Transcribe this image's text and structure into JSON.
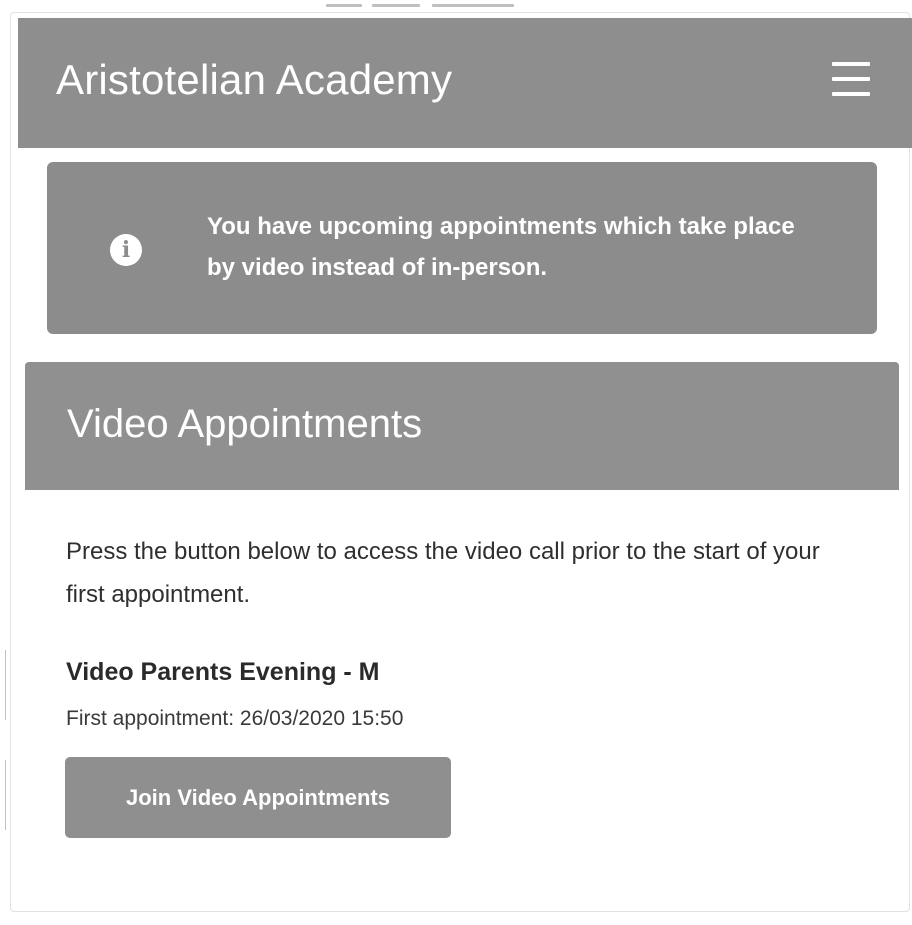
{
  "header": {
    "title": "Aristotelian Academy",
    "menu_icon": "hamburger-menu-icon"
  },
  "alert": {
    "icon": "info-icon",
    "icon_glyph": "i",
    "message": "You have upcoming appointments which take place by video instead of in-person."
  },
  "video_card": {
    "title": "Video Appointments",
    "instructions": "Press the button below to access the video call prior to the start of your first appointment.",
    "event_name": "Video Parents Evening - M",
    "first_appointment": "First appointment: 26/03/2020 15:50",
    "join_button_label": "Join Video Appointments"
  },
  "colors": {
    "header_bg": "#8e8e8e",
    "alert_bg": "#8c8c8c",
    "button_bg": "#8f8f8f",
    "text_dark": "#2f2f2f"
  }
}
